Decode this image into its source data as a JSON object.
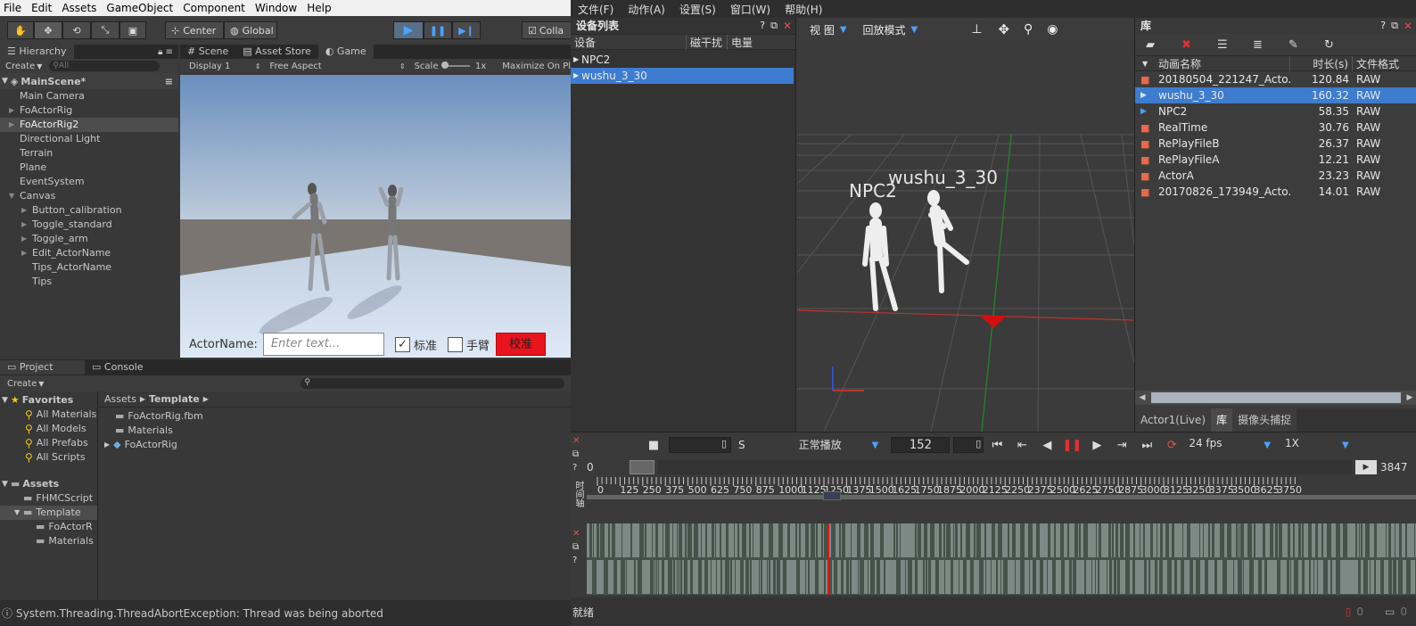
{
  "unity": {
    "menu": [
      "File",
      "Edit",
      "Assets",
      "GameObject",
      "Component",
      "Window",
      "Help"
    ],
    "toolbar": {
      "center": "Center",
      "global": "Global",
      "collab": "Colla"
    },
    "hierarchy": {
      "tab": "Hierarchy",
      "create": "Create",
      "search": "All",
      "scene": "MainScene*",
      "items": [
        {
          "label": "Main Camera",
          "indent": 1,
          "arrow": false
        },
        {
          "label": "FoActorRig",
          "indent": 1,
          "arrow": true
        },
        {
          "label": "FoActorRig2",
          "indent": 1,
          "arrow": true,
          "sel": true
        },
        {
          "label": "Directional Light",
          "indent": 1,
          "arrow": false
        },
        {
          "label": "Terrain",
          "indent": 1,
          "arrow": false
        },
        {
          "label": "Plane",
          "indent": 1,
          "arrow": false
        },
        {
          "label": "EventSystem",
          "indent": 1,
          "arrow": false
        },
        {
          "label": "Canvas",
          "indent": 1,
          "arrow": true,
          "open": true
        },
        {
          "label": "Button_calibration",
          "indent": 2,
          "arrow": true
        },
        {
          "label": "Toggle_standard",
          "indent": 2,
          "arrow": true
        },
        {
          "label": "Toggle_arm",
          "indent": 2,
          "arrow": true
        },
        {
          "label": "Edit_ActorName",
          "indent": 2,
          "arrow": true
        },
        {
          "label": "Tips_ActorName",
          "indent": 2,
          "arrow": false
        },
        {
          "label": "Tips",
          "indent": 2,
          "arrow": false
        }
      ]
    },
    "tabs": {
      "scene": "Scene",
      "store": "Asset Store",
      "game": "Game"
    },
    "gamebar": {
      "display": "Display 1",
      "aspect": "Free Aspect",
      "scale": "Scale",
      "scale_val": "1x",
      "maximize": "Maximize On Pl"
    },
    "gameui": {
      "actor_label": "ActorName:",
      "placeholder": "Enter text...",
      "standard": "标准",
      "arm": "手臂",
      "calibrate": "校准"
    },
    "project": {
      "tab": "Project",
      "console": "Console",
      "create": "Create",
      "favorites": "Favorites",
      "fav_items": [
        "All Materials",
        "All Models",
        "All Prefabs",
        "All Scripts"
      ],
      "assets": "Assets",
      "asset_items": [
        {
          "label": "FHMCScript",
          "indent": 1
        },
        {
          "label": "Template",
          "indent": 1,
          "sel": true
        },
        {
          "label": "FoActorR",
          "indent": 2
        },
        {
          "label": "Materials",
          "indent": 2
        }
      ],
      "breadcrumb": [
        "Assets",
        "Template"
      ],
      "files": [
        "FoActorRig.fbm",
        "Materials",
        "FoActorRig"
      ]
    },
    "status": "System.Threading.ThreadAbortException: Thread was being aborted"
  },
  "app": {
    "menu": [
      "文件(F)",
      "动作(A)",
      "设置(S)",
      "窗口(W)",
      "帮助(H)"
    ],
    "devices": {
      "title": "设备列表",
      "cols": [
        "设备",
        "磁干扰",
        "电量"
      ],
      "rows": [
        "NPC2",
        "wushu_3_30"
      ]
    },
    "viewport": {
      "view": "视 图",
      "mode": "回放模式",
      "label1": "NPC2",
      "label2": "wushu_3_30"
    },
    "library": {
      "title": "库",
      "cols": [
        "动画名称",
        "时长(s)",
        "文件格式"
      ],
      "rows": [
        {
          "name": "20180504_221247_Acto...",
          "dur": "120.84",
          "fmt": "RAW",
          "icon": "rec"
        },
        {
          "name": "wushu_3_30",
          "dur": "160.32",
          "fmt": "RAW",
          "icon": "play",
          "sel": true
        },
        {
          "name": "NPC2",
          "dur": "58.35",
          "fmt": "RAW",
          "icon": "play"
        },
        {
          "name": "RealTime",
          "dur": "30.76",
          "fmt": "RAW",
          "icon": "rec"
        },
        {
          "name": "RePlayFileB",
          "dur": "26.37",
          "fmt": "RAW",
          "icon": "rec"
        },
        {
          "name": "RePlayFileA",
          "dur": "12.21",
          "fmt": "RAW",
          "icon": "rec"
        },
        {
          "name": "ActorA",
          "dur": "23.23",
          "fmt": "RAW",
          "icon": "rec"
        },
        {
          "name": "20170826_173949_Acto...",
          "dur": "14.01",
          "fmt": "RAW",
          "icon": "rec"
        }
      ],
      "tabs": [
        "Actor1(Live)",
        "库",
        "摄像头捕捉"
      ]
    },
    "controls": {
      "s_label": "S",
      "play_mode": "正常播放",
      "frame": "152",
      "fps": "24 fps",
      "speed": "1X",
      "start": "0",
      "end": "3847",
      "timeline_label": "时间轴",
      "ticks": [
        "0",
        "125",
        "250",
        "375",
        "500",
        "625",
        "750",
        "875",
        "1000",
        "1125",
        "1250",
        "1375",
        "1500",
        "1625",
        "1750",
        "1875",
        "2000",
        "2125",
        "2250",
        "2375",
        "2500",
        "2625",
        "2750",
        "2875",
        "3000",
        "3125",
        "3250",
        "3375",
        "3500",
        "3625",
        "3750"
      ]
    },
    "status": "就绪",
    "status_counts": [
      "0",
      "0"
    ]
  }
}
